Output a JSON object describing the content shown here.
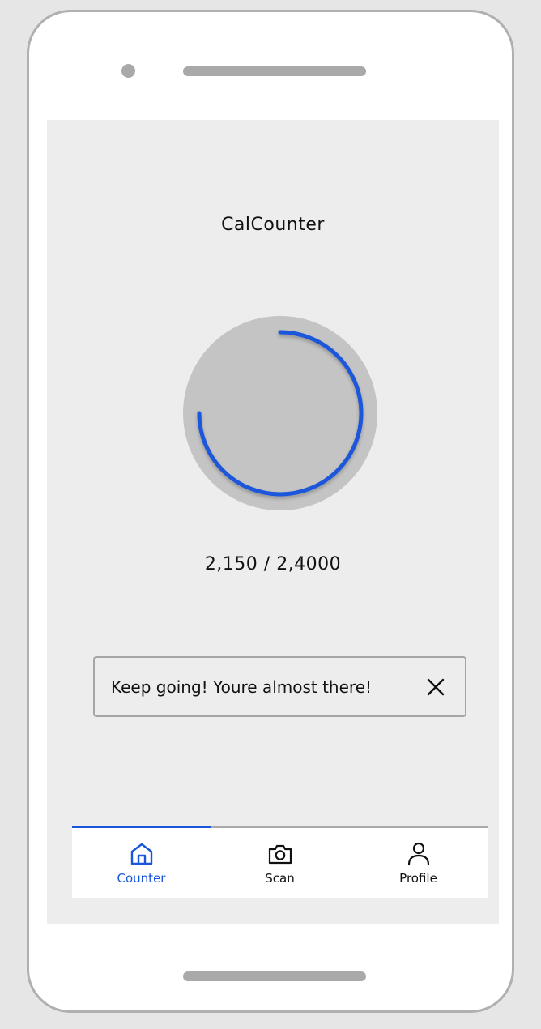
{
  "app": {
    "title": "CalCounter"
  },
  "counter": {
    "readout": "2,150 / 2,4000",
    "progress_fraction": 0.75
  },
  "toast": {
    "message": "Keep going! Youre almost there!"
  },
  "nav": {
    "items": [
      {
        "label": "Counter",
        "icon": "home-icon",
        "active": true
      },
      {
        "label": "Scan",
        "icon": "camera-icon",
        "active": false
      },
      {
        "label": "Profile",
        "icon": "user-icon",
        "active": false
      }
    ]
  },
  "colors": {
    "accent": "#1a56db",
    "ring_track": "#c4c4c4",
    "screen_bg": "#ededed"
  }
}
